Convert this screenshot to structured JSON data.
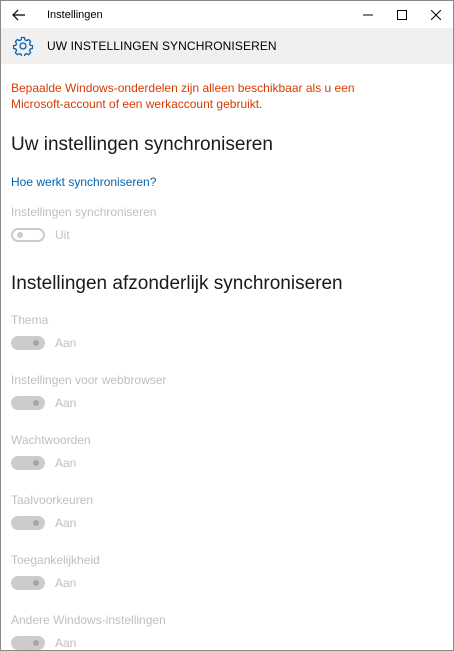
{
  "window": {
    "title": "Instellingen"
  },
  "header": {
    "title": "UW INSTELLINGEN SYNCHRONISEREN",
    "icon": "gear-icon"
  },
  "warning": "Bepaalde Windows-onderdelen zijn alleen beschikbaar als u een Microsoft-account of een werkaccount gebruikt.",
  "section1": {
    "title": "Uw instellingen synchroniseren",
    "link": "Hoe werkt synchroniseren?",
    "setting": {
      "label": "Instellingen synchroniseren",
      "state": "Uit"
    }
  },
  "section2": {
    "title": "Instellingen afzonderlijk synchroniseren",
    "items": [
      {
        "label": "Thema",
        "state": "Aan"
      },
      {
        "label": "Instellingen voor webbrowser",
        "state": "Aan"
      },
      {
        "label": "Wachtwoorden",
        "state": "Aan"
      },
      {
        "label": "Taalvoorkeuren",
        "state": "Aan"
      },
      {
        "label": "Toegankelijkheid",
        "state": "Aan"
      },
      {
        "label": "Andere Windows-instellingen",
        "state": "Aan"
      }
    ]
  },
  "colors": {
    "warning": "#d83b01",
    "link": "#0063b1",
    "disabled_text": "#bfbfbf",
    "header_bg": "#f0f0f0"
  }
}
